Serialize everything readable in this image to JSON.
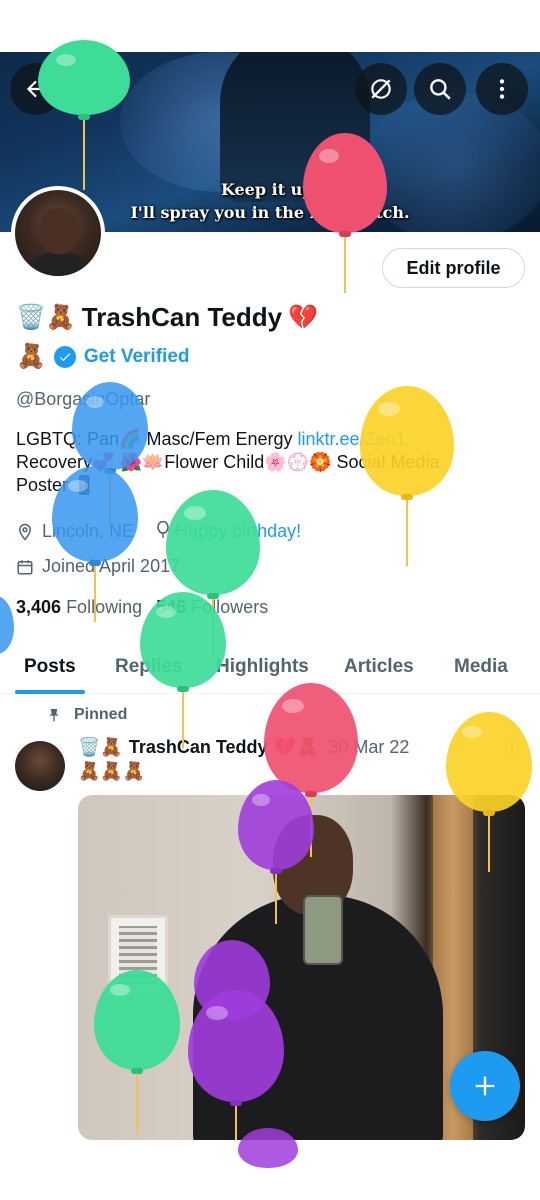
{
  "header": {
    "banner_subtitle_line1": "Keep it up.",
    "banner_subtitle_line2": "I'll spray you in the face, bitch."
  },
  "profile": {
    "name_prefix_emoji": "🗑️🧸",
    "name": "TrashCan Teddy",
    "name_suffix_emoji": "💔",
    "verify_prefix_emoji": "🧸",
    "get_verified_label": "Get Verified",
    "edit_profile_label": "Edit profile",
    "handle": "@BorgasinOptar",
    "bio_line1_text": "LGBTQ: Pan🌈 Masc/Fem Energy ",
    "bio_link": "linktr.ee/Zeo1",
    "bio_line2": "Recovery💞 🌺🪷Flower Child🌸💮🏵️ Social Media",
    "bio_line3": "Poster 📱",
    "location": "Lincoln, NE",
    "birthday": "Happy birthday!",
    "joined": "Joined April 2017",
    "following_count": "3,406",
    "following_label": "Following",
    "followers_count": "546",
    "followers_label": "Followers"
  },
  "tabs": [
    {
      "label": "Posts"
    },
    {
      "label": "Replies"
    },
    {
      "label": "Highlights"
    },
    {
      "label": "Articles"
    },
    {
      "label": "Media"
    }
  ],
  "post": {
    "pinned_label": "Pinned",
    "author_prefix_emoji": "🗑️🧸",
    "author_name": "TrashCan Teddy",
    "author_suffix_emoji": "💔🧸",
    "date": "30 Mar 22",
    "emoji_line": "🧸🧸🧸"
  },
  "icons": {
    "back": "arrow-left-icon",
    "grok": "grok-icon",
    "search": "search-icon",
    "more": "more-vertical-icon",
    "compose": "plus-icon"
  },
  "colors": {
    "accent": "#1d9bf0",
    "text": "#0f1419",
    "secondary": "#536471"
  }
}
